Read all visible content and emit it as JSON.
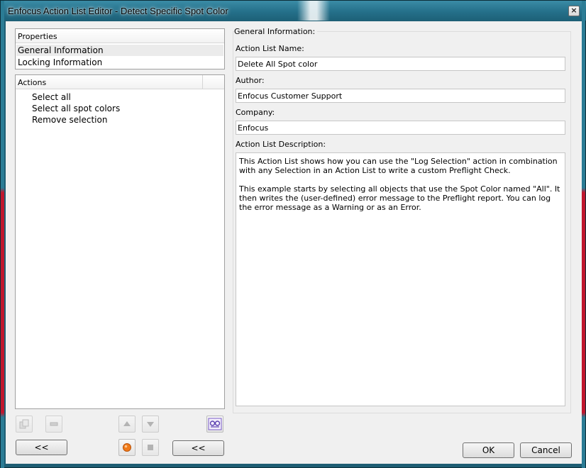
{
  "window": {
    "title": "Enfocus Action List Editor - Detect Specific Spot Color",
    "close_glyph": "×"
  },
  "properties_panel": {
    "header": "Properties",
    "items": [
      {
        "label": "General Information",
        "selected": true
      },
      {
        "label": "Locking Information",
        "selected": false
      }
    ]
  },
  "actions_panel": {
    "header": "Actions",
    "items": [
      "Select all",
      "Select all spot colors",
      "Remove selection"
    ]
  },
  "toolbar": {
    "icons": [
      "duplicate-icon",
      "remove-icon",
      "move-up-icon",
      "move-down-icon",
      "glasses-icon",
      "record-icon",
      "stop-icon"
    ],
    "collapse_left_label": "<<",
    "collapse_right_label": "<<"
  },
  "general_information": {
    "group_label": "General Information:",
    "name_label": "Action List Name:",
    "name_value": "Delete All Spot color",
    "author_label": "Author:",
    "author_value": "Enfocus Customer Support",
    "company_label": "Company:",
    "company_value": "Enfocus",
    "description_label": "Action List Description:",
    "description_p1": "This Action List shows how you can use the \"Log Selection\" action in combination with any Selection in an Action List to write a custom Preflight Check.",
    "description_p2": "This example starts by selecting all objects that use the Spot Color named \"All\". It then writes the (user-defined) error message to the Preflight report. You can log the error message as a Warning or as an Error."
  },
  "footer": {
    "ok_label": "OK",
    "cancel_label": "Cancel"
  },
  "colors": {
    "title_bar": "#25708a",
    "dialog_bg": "#f0f0f0",
    "record_orange": "#f07a1a"
  }
}
